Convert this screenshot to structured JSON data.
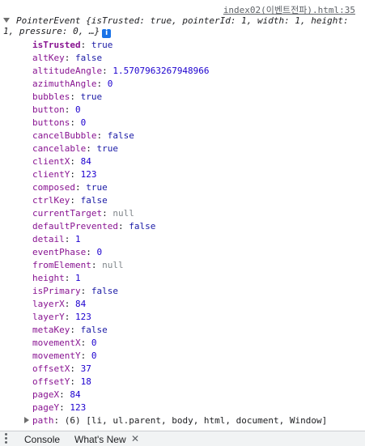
{
  "source_link": "index02(이벤트전파).html:35",
  "event_summary": {
    "class_name": "PointerEvent",
    "preview": "{isTrusted: true, pointerId: 1, width: 1, height: 1, pressure: 0, …}"
  },
  "properties": [
    {
      "key": "isTrusted",
      "value": "true"
    },
    {
      "key": "altKey",
      "value": "false"
    },
    {
      "key": "altitudeAngle",
      "value": "1.5707963267948966"
    },
    {
      "key": "azimuthAngle",
      "value": "0"
    },
    {
      "key": "bubbles",
      "value": "true"
    },
    {
      "key": "button",
      "value": "0"
    },
    {
      "key": "buttons",
      "value": "0"
    },
    {
      "key": "cancelBubble",
      "value": "false"
    },
    {
      "key": "cancelable",
      "value": "true"
    },
    {
      "key": "clientX",
      "value": "84"
    },
    {
      "key": "clientY",
      "value": "123"
    },
    {
      "key": "composed",
      "value": "true"
    },
    {
      "key": "ctrlKey",
      "value": "false"
    },
    {
      "key": "currentTarget",
      "value": "null"
    },
    {
      "key": "defaultPrevented",
      "value": "false"
    },
    {
      "key": "detail",
      "value": "1"
    },
    {
      "key": "eventPhase",
      "value": "0"
    },
    {
      "key": "fromElement",
      "value": "null"
    },
    {
      "key": "height",
      "value": "1"
    },
    {
      "key": "isPrimary",
      "value": "false"
    },
    {
      "key": "layerX",
      "value": "84"
    },
    {
      "key": "layerY",
      "value": "123"
    },
    {
      "key": "metaKey",
      "value": "false"
    },
    {
      "key": "movementX",
      "value": "0"
    },
    {
      "key": "movementY",
      "value": "0"
    },
    {
      "key": "offsetX",
      "value": "37"
    },
    {
      "key": "offsetY",
      "value": "18"
    },
    {
      "key": "pageX",
      "value": "84"
    },
    {
      "key": "pageY",
      "value": "123"
    }
  ],
  "path_property": {
    "key": "path",
    "value": "(6) [li, ul.parent, body, html, document, Window]"
  },
  "drawer": {
    "tabs": [
      "Console",
      "What's New"
    ],
    "close_glyph": "✕"
  },
  "colors": {
    "key": "#881391",
    "boolean": "#1a1aa6",
    "number": "#1c00cf",
    "null": "#80868b",
    "info_icon": "#1a73e8"
  },
  "icons": {
    "expand": "triangle-down-icon",
    "collapsed": "triangle-right-icon",
    "info": "info-icon",
    "drawer_menu": "kebab-menu-icon",
    "close": "close-icon"
  }
}
